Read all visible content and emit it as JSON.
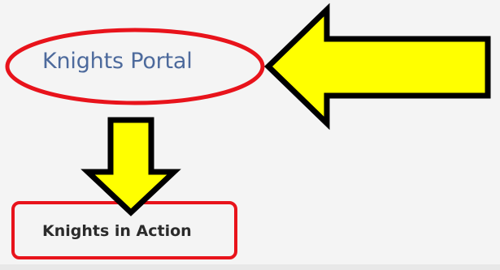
{
  "nav": {
    "portal_label": "Knights Portal",
    "action_label": "Knights in Action"
  },
  "annotations": {
    "highlight_color": "#e8131b",
    "arrow_fill": "#ffff00",
    "arrow_stroke": "#000000"
  }
}
